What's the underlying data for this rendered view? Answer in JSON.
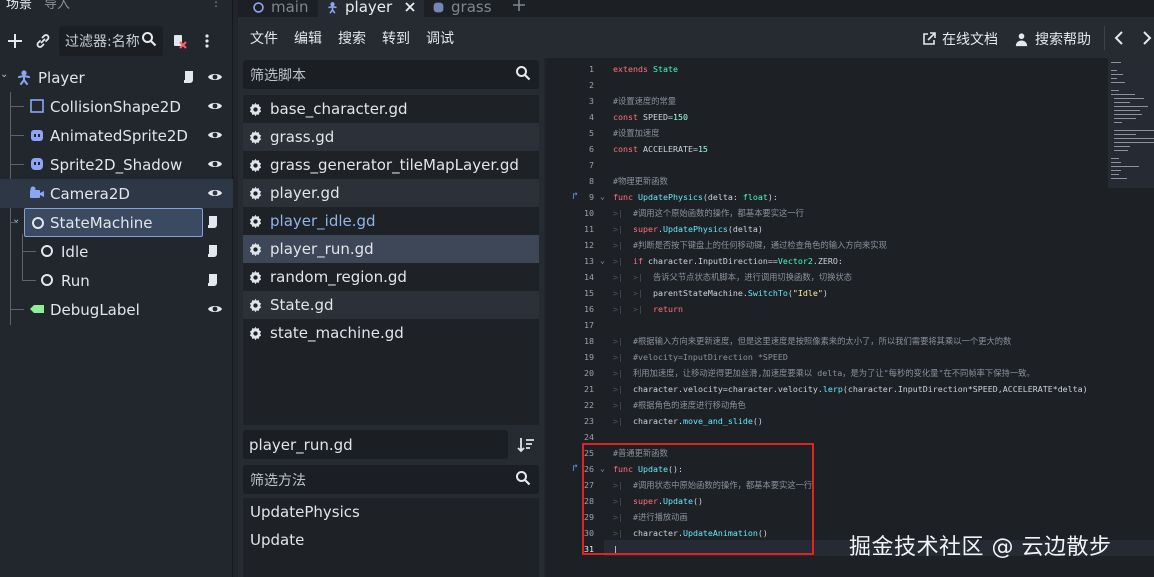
{
  "scene_dock": {
    "tabs": [
      "场景",
      "导入"
    ],
    "filter_placeholder": "过滤器:名称",
    "nodes": [
      {
        "name": "Player",
        "icon": "character-body-icon"
      },
      {
        "name": "CollisionShape2D",
        "icon": "collision-shape-icon"
      },
      {
        "name": "AnimatedSprite2D",
        "icon": "animated-sprite-icon"
      },
      {
        "name": "Sprite2D_Shadow",
        "icon": "sprite-icon"
      },
      {
        "name": "Camera2D",
        "icon": "camera-icon"
      },
      {
        "name": "StateMachine",
        "icon": "node-icon"
      },
      {
        "name": "Idle",
        "icon": "node-icon"
      },
      {
        "name": "Run",
        "icon": "node-icon"
      },
      {
        "name": "DebugLabel",
        "icon": "label-icon"
      }
    ]
  },
  "editor_tabs": [
    {
      "label": "main",
      "active": false
    },
    {
      "label": "player",
      "active": true
    },
    {
      "label": "grass",
      "active": false
    }
  ],
  "menu": {
    "items": [
      "文件",
      "编辑",
      "搜索",
      "转到",
      "调试"
    ],
    "online_docs": "在线文档",
    "search_help": "搜索帮助"
  },
  "script_panel": {
    "filter_scripts_placeholder": "筛选脚本",
    "scripts": [
      "base_character.gd",
      "grass.gd",
      "grass_generator_tileMapLayer.gd",
      "player.gd",
      "player_idle.gd",
      "player_run.gd",
      "random_region.gd",
      "State.gd",
      "state_machine.gd"
    ],
    "current_file": "player_run.gd",
    "filter_methods_placeholder": "筛选方法",
    "methods": [
      "UpdatePhysics",
      "Update"
    ]
  },
  "code": {
    "current_line": 31,
    "lines": [
      {
        "n": 1,
        "t": "extends State"
      },
      {
        "n": 2,
        "t": ""
      },
      {
        "n": 3,
        "t": "#设置速度的常量"
      },
      {
        "n": 4,
        "t": "const SPEED=150"
      },
      {
        "n": 5,
        "t": "#设置加速度"
      },
      {
        "n": 6,
        "t": "const ACCELERATE=15"
      },
      {
        "n": 7,
        "t": ""
      },
      {
        "n": 8,
        "t": "#物理更新函数"
      },
      {
        "n": 9,
        "t": "func UpdatePhysics(delta: float):"
      },
      {
        "n": 10,
        "t": "    #调用这个原始函数的操作，都基本要实这一行"
      },
      {
        "n": 11,
        "t": "    super.UpdatePhysics(delta)"
      },
      {
        "n": 12,
        "t": "    #判断是否按下键盘上的任何移动键，通过检查角色的输入方向来实现"
      },
      {
        "n": 13,
        "t": "    if character.InputDirection==Vector2.ZERO:"
      },
      {
        "n": 14,
        "t": "        告诉父节点状态机脚本，进行调用切换函数，切换状态"
      },
      {
        "n": 15,
        "t": "        parentStateMachine.SwitchTo(\"Idle\")"
      },
      {
        "n": 16,
        "t": "        return"
      },
      {
        "n": 17,
        "t": ""
      },
      {
        "n": 18,
        "t": "    #根据输入方向来更新速度，但是这里速度是按照像素来的太小了，所以我们需要将其乘以一个更大的数"
      },
      {
        "n": 19,
        "t": "    #velocity=InputDirection *SPEED"
      },
      {
        "n": 20,
        "t": "    利用加速度，让移动逆得更加丝滑,加速度要乘以 delta，是为了让\"每秒的变化量\"在不同帧率下保持一致。"
      },
      {
        "n": 21,
        "t": "    character.velocity=character.velocity.lerp(character.InputDirection*SPEED,ACCELERATE*delta)"
      },
      {
        "n": 22,
        "t": "    #根据角色的速度进行移动角色"
      },
      {
        "n": 23,
        "t": "    character.move_and_slide()"
      },
      {
        "n": 24,
        "t": ""
      },
      {
        "n": 25,
        "t": "#普通更新函数"
      },
      {
        "n": 26,
        "t": "func Update():"
      },
      {
        "n": 27,
        "t": "    #调用状态中原始函数的操作，都基本要实这一行"
      },
      {
        "n": 28,
        "t": "    super.Update()"
      },
      {
        "n": 29,
        "t": "    #进行播放动画"
      },
      {
        "n": 30,
        "t": "    character.UpdateAnimation()"
      },
      {
        "n": 31,
        "t": ""
      }
    ]
  },
  "watermark": "掘金技术社区 @ 云边散步"
}
